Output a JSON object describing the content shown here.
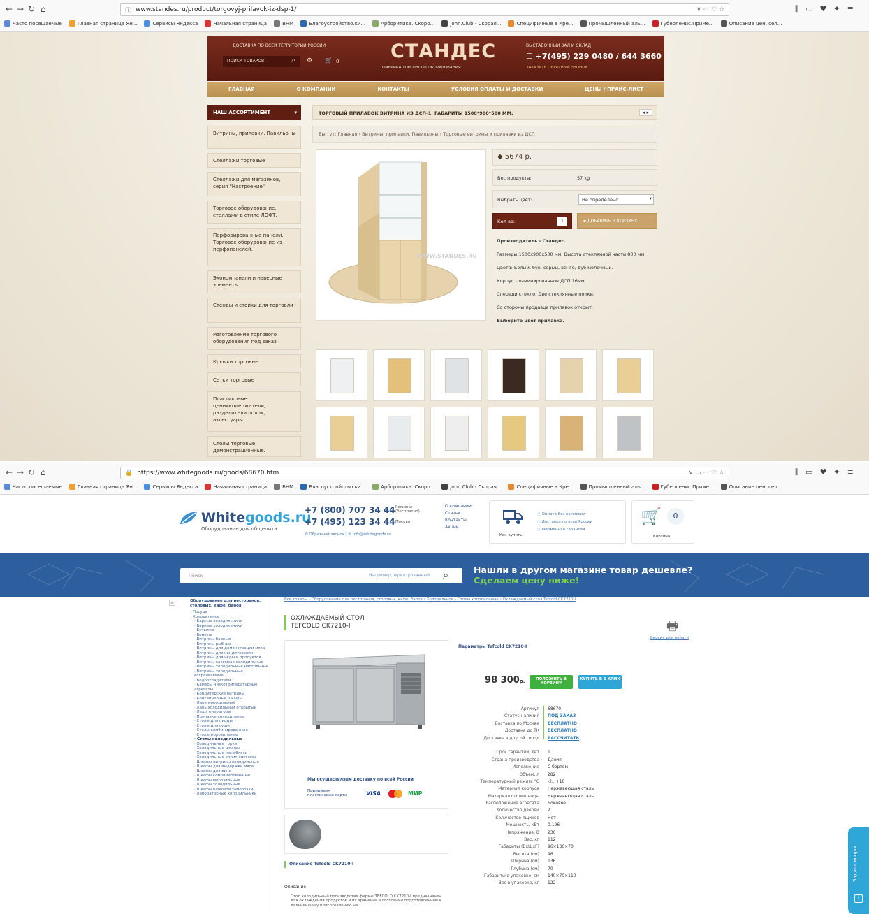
{
  "browser1": {
    "url": "www.standes.ru/product/torgovyj-prilavok-iz-dsp-1/",
    "bookmarks": [
      "Часто посещаемые",
      "Главная страница Ян...",
      "Сервисы Яндекса",
      "Начальная страница",
      "ВНМ",
      "Благоустройство.ки...",
      "Арборитика. Скоро...",
      "John.Club - Скорая...",
      "Специфичные в Кре...",
      "Промышленный аль...",
      "Губерленис.Приме...",
      "Описание цен, сел..."
    ]
  },
  "stand": {
    "top_left_line": "ДОСТАВКА ПО ВСЕЙ ТЕРРИТОРИИ РОССИИ",
    "search_placeholder": "ПОИСК ТОВАРОВ",
    "cart_count": "0",
    "logo": "СТАНДЕС",
    "logo_sub": "ФАБРИКА ТОРГОВОГО ОБОРУДОВАНИЯ",
    "phone_caption": "ВЫСТАВОЧНЫЙ ЗАЛ И СКЛАД",
    "phone": "+7(495) 229 0480 / 644 3660",
    "callback": "ЗАКАЗАТЬ ОБРАТНЫЙ ЗВОНОК",
    "menu": [
      "ГЛАВНАЯ",
      "О КОМПАНИИ",
      "КОНТАКТЫ",
      "УСЛОВИЯ ОПЛАТЫ И ДОСТАВКИ",
      "ЦЕНЫ / ПРАЙС-ЛИСТ"
    ],
    "sidebar_title": "НАШ АССОРТИМЕНТ",
    "sidebar": [
      "Витрины, прилавки. Павильоны",
      "Стеллажи торговые",
      "Стеллажи для магазинов, серия \"Настроение\"",
      "Торговое оборудование, стеллажи в стиле ЛОФТ.",
      "Перфорированные панели. Торговое оборудование из перфопанелей.",
      "Экономпанели и навесные элементы",
      "Стенды и стойки для торговли",
      "Изготовление торгового оборудования под заказ",
      "Крючки торговые",
      "Сетки торговые",
      "Пластиковые ценникодержатели, разделители полок, аксессуары.",
      "Столы торговые, демонстрационные."
    ],
    "product_title": "ТОРГОВЫЙ ПРИЛАВОК ВИТРИНА ИЗ ДСП-1. ГАБАРИТЫ 1500*900*500 ММ.",
    "breadcrumb": "Вы тут: Главная › Витрины, прилавки. Павильоны › Торговые витрины и прилавки из ДСП",
    "price": "5674 р.",
    "weight_label": "Вес продукта:",
    "weight_value": "57 kg",
    "color_label": "Выбрать цвет:",
    "color_value": "Не определено",
    "qty_label": "Кол-во:",
    "qty_value": "1",
    "add_cart": "ДОБАВИТЬ В КОРЗИНУ",
    "watermark": "WWW.STANDES.RU",
    "desc": [
      "Производитель - Стандес.",
      "Размеры 1500х900х500 мм. Высота стеклянной части 800 мм.",
      "Цвета: Белый, бук, серый, венге, дуб молочный.",
      "Корпус - ламинированное ДСП 16мм.",
      "Спереди стекло. Две стеклянные полки.",
      "Со стороны продавца прилавок открыт.",
      "Выберите цвет прилавка."
    ]
  },
  "browser2": {
    "url": "https://www.whitegoods.ru/goods/68670.htm"
  },
  "wg": {
    "logo_a": "White",
    "logo_b": "goods.ru",
    "logo_sub": "Оборудование для общепита",
    "phone1": "+7 (800) 707 34 44",
    "phone1_note": "Регионы (бесплатно)",
    "phone2": "+7 (495) 123 34 44",
    "phone2_note": "Москва",
    "callback": "Обратный звонок",
    "email": "info@whitegoods.ru",
    "links": [
      "О компании",
      "Статьи",
      "Контакты",
      "Акции"
    ],
    "how_buy": "Как купить",
    "features": [
      "Оплата без комиссии",
      "Доставка по всей России",
      "Фирменная гарантия"
    ],
    "cart_label": "Корзина",
    "cart_count": "0",
    "search_placeholder": "Поиск",
    "search_hint": "Например, Фрилтрованный",
    "promo1": "Нашли в другом магазине товар дешевле?",
    "promo2": "Сделаем цену ниже!",
    "breadcrumb": "Все товары › Оборудование для ресторанов, столовых, кафе, баров › Холодильное › Столы холодильные › Охлаждаемый стол Tefcold CK7210-I",
    "title1": "ОХЛАЖДАЕМЫЙ СТОЛ",
    "title2": "TEFCOLD CK7210-I",
    "print": "Версия для печати",
    "params_title": "Параметры Tefcold CK7210-I",
    "price": "98 300",
    "currency": "р.",
    "btn_cart": "ПОЛОЖИТЬ В КОРЗИНУ",
    "btn_oneclick": "КУПИТЬ В 1 КЛИК",
    "delivery_note": "Мы осуществляем доставку по всей России",
    "pay_note": "Принимаем пластиковые карты",
    "pay_brands": [
      "VISA",
      "МИР"
    ],
    "desc_title": "Описание Tefcold CK7210-I",
    "desc_sub": "Описание",
    "desc_text": "Стол холодильный производства фирмы TEFCOLD CK7210-I предназначен для охлаждения продуктов и их хранения в состоянии подготовленном к дальнейшему приготовлению на",
    "ask": "Задать вопрос",
    "side_title": "Оборудование для ресторанов, столовых, кафе, баров",
    "side_items": [
      "Посуда",
      "Холодильное",
      "Барные холодильники",
      "Барные холодильники",
      "Бутылко",
      "Бонеты",
      "Витрины барные",
      "Витрины рыбные",
      "Витрины для демонстрации мяса",
      "Витрины для кондитерских",
      "Витрины для икры и продуктов",
      "Витрины кассовые холодильные",
      "Витрины холодильные настольные",
      "Витрины холодильные встраиваемые",
      "Водоохладители",
      "Камеры низкотемпературные агрегаты",
      "Кондитерские витрины",
      "Контейнерные шкафы",
      "Ларь морозильный",
      "Ларь холодильный открытый",
      "Льдогенераторы",
      "Прилавки холодильные",
      "Столы для пиццы",
      "Столы для суши",
      "Столы комбинированные",
      "Столы морозильные",
      "Столы холодильные",
      "Холодильные горки",
      "Холодильные шкафы",
      "Холодильные моноблоки",
      "Холодильные сплит-системы",
      "Шкафы-витрины холодильные",
      "Шкафы для выдержки мяса",
      "Шкафы для вина",
      "Шкафы комбинированные",
      "Шкафы морозильные",
      "Шкафы холодильные",
      "Шкафы шоковой заморозки",
      "Лабораторные холодильники"
    ],
    "specs": [
      [
        "Артикул",
        "68670"
      ],
      [
        "Статус наличия",
        "ПОД ЗАКАЗ"
      ],
      [
        "Доставка по Москве",
        "БЕСПЛАТНО"
      ],
      [
        "Доставка до ТК",
        "БЕСПЛАТНО"
      ],
      [
        "Доставка в другой город",
        "РАССЧИТАТЬ"
      ],
      [
        "",
        ""
      ],
      [
        "Срок гарантии, лет",
        "1"
      ],
      [
        "Страна производства",
        "Дания"
      ],
      [
        "Исполнение",
        "С бортом"
      ],
      [
        "Объем, л",
        "282"
      ],
      [
        "Температурный режим, °С",
        "-2...+10"
      ],
      [
        "Материал корпуса",
        "Нержавеющая сталь"
      ],
      [
        "Материал столешницы",
        "Нержавеющая сталь"
      ],
      [
        "Расположение агрегата",
        "Боковое"
      ],
      [
        "Количество дверей",
        "2"
      ],
      [
        "Количество ящиков",
        "Нет"
      ],
      [
        "Мощность, кВт",
        "0.196"
      ],
      [
        "Напряжение, В",
        "230"
      ],
      [
        "Вес, кг",
        "112"
      ],
      [
        "Габариты (ВхШхГ)",
        "96×136×70"
      ],
      [
        "Высота (см)",
        "96"
      ],
      [
        "Ширина (см)",
        "136"
      ],
      [
        "Глубина (см)",
        "70"
      ],
      [
        "Габариты в упаковке, см",
        "140×70×110"
      ],
      [
        "Вес в упаковке, кг",
        "122"
      ]
    ]
  }
}
